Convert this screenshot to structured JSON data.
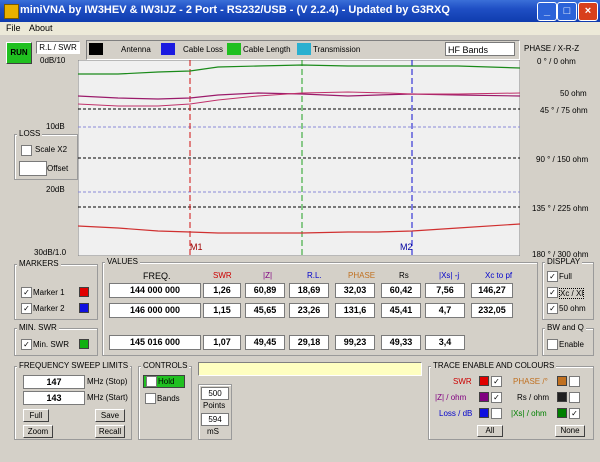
{
  "window": {
    "title": "miniVNA by IW3HEV & IW3IJZ - 2 Port - RS232/USB - (V 2.2.4) - Updated by G3RXQ"
  },
  "menu": [
    "File",
    "About"
  ],
  "toolbar": {
    "run": "RUN",
    "rl_swr": "R.L / SWR",
    "antenna": "Antenna",
    "cable_loss": "Cable Loss",
    "cable_length": "Cable Length",
    "transmission": "Transmission",
    "bands": "HF Bands",
    "phase_hdr": "PHASE / X-R-Z"
  },
  "left_axis": {
    "top": "0dB/10",
    "l10": "10dB",
    "l20": "20dB",
    "bottom": "30dB/1.0"
  },
  "right_axis": {
    "r0": "0 ° / 0 ohm",
    "r50": "50 ohm",
    "r45": "45 ° / 75 ohm",
    "r90": "90 ° / 150 ohm",
    "r135": "135 ° / 225 ohm",
    "r180": "180 ° / 300 ohm"
  },
  "loss": {
    "title": "LOSS",
    "scale": "Scale X2",
    "offset": "Offset"
  },
  "markers_on_plot": {
    "m1": "M1",
    "m2": "M2"
  },
  "values": {
    "title": "VALUES",
    "headers": [
      "FREQ.",
      "SWR",
      "|Z|",
      "R.L.",
      "PHASE",
      "Rs",
      "|Xs| -j",
      "Xc to pf"
    ],
    "marker1": [
      "144 000 000",
      "1,26",
      "60,89",
      "18,69",
      "32,03",
      "60,42",
      "7,56",
      "146,27"
    ],
    "marker2": [
      "146 000 000",
      "1,15",
      "45,65",
      "23,26",
      "131,6",
      "45,41",
      "4,7",
      "232,05"
    ],
    "minswr": [
      "145 016 000",
      "1,07",
      "49,45",
      "29,18",
      "99,23",
      "49,33",
      "3,4",
      ""
    ]
  },
  "markers": {
    "title": "MARKERS",
    "m1": "Marker 1",
    "m2": "Marker 2"
  },
  "min_swr": {
    "title": "MIN. SWR",
    "label": "Min. SWR"
  },
  "display": {
    "title": "DISPLAY",
    "full": "Full",
    "xcx": "Xc / Xl",
    "ohm50": "50 ohm"
  },
  "bwq": {
    "title": "BW and Q",
    "enable": "Enable"
  },
  "sweep": {
    "title": "FREQUENCY SWEEP LIMITS",
    "stop_val": "147",
    "stop_lbl": "MHz (Stop)",
    "start_val": "143",
    "start_lbl": "MHz (Start)",
    "full": "Full",
    "save": "Save",
    "zoom": "Zoom",
    "recall": "Recall"
  },
  "controls": {
    "title": "CONTROLS",
    "hold": "Hold",
    "bands": "Bands",
    "points_val": "500",
    "points_lbl": "Points",
    "ms_val": "594",
    "ms_lbl": "mS"
  },
  "trace": {
    "title": "TRACE ENABLE AND COLOURS",
    "swr": "SWR",
    "phase": "PHASE /°",
    "z": "|Z| / ohm",
    "rs": "Rs / ohm",
    "loss": "Loss / dB",
    "xs": "|Xs| / ohm",
    "all": "All",
    "none": "None"
  },
  "colors": {
    "swr": "#cc0000",
    "phase": "#c07020",
    "z": "#800080",
    "rs": "#202020",
    "loss": "#0000cc",
    "xs": "#008000",
    "plot_bg": "#f0f0f0",
    "green_trace": "#008000",
    "purple_trace": "#9b1b6b",
    "red_trace": "#d03030"
  }
}
